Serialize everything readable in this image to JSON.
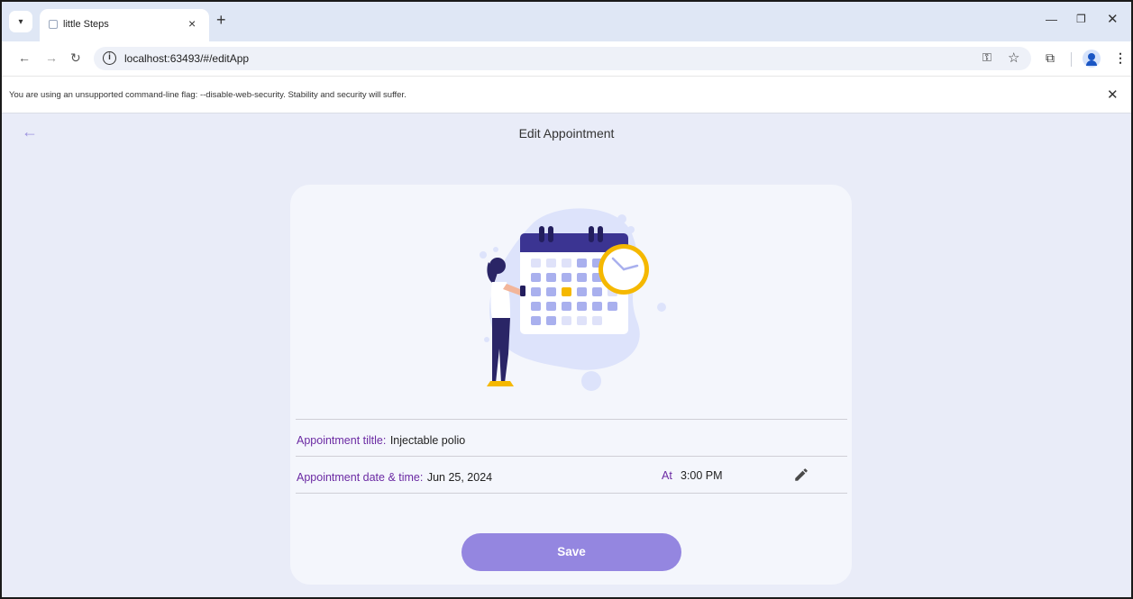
{
  "browser": {
    "tab_title": "little Steps",
    "url": "localhost:63493/#/editApp",
    "infobar_text": "You are using an unsupported command-line flag: --disable-web-security. Stability and security will suffer."
  },
  "app": {
    "title": "Edit Appointment",
    "title_label": "Appointment tiltle:",
    "title_value": "Injectable polio",
    "date_label": "Appointment date & time:",
    "date_value": "Jun 25, 2024",
    "at_label": "At",
    "time_value": "3:00 PM",
    "save_label": "Save"
  },
  "colors": {
    "accent": "#9486e0",
    "label": "#6b2aa3",
    "page_bg": "#e9ecf8",
    "card_bg": "#f4f6fc",
    "illustration_primary": "#3b3492",
    "illustration_highlight": "#f5b800"
  },
  "icons": [
    "dropdown-icon",
    "tab-favicon-icon",
    "close-icon",
    "plus-icon",
    "minimize-icon",
    "restore-icon",
    "back-icon",
    "forward-icon",
    "reload-icon",
    "info-icon",
    "key-icon",
    "star-icon",
    "extensions-icon",
    "profile-icon",
    "more-icon",
    "back-arrow-icon",
    "pencil-icon"
  ]
}
